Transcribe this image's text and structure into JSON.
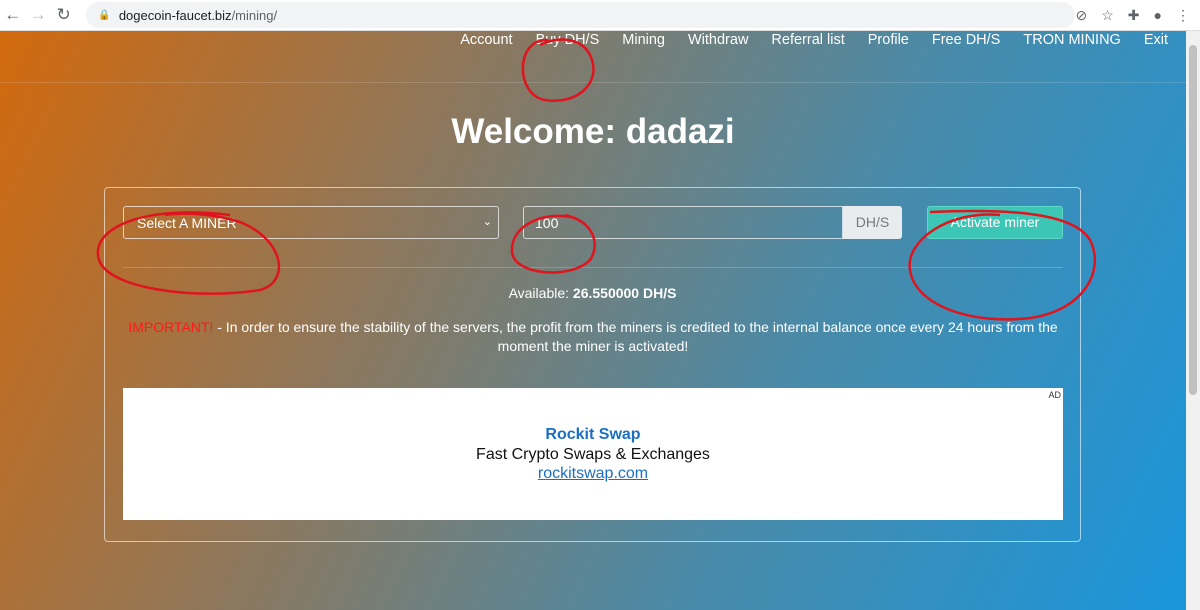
{
  "browser": {
    "url_domain": "dogecoin-faucet.biz",
    "url_path": "/mining/"
  },
  "nav": [
    "Account",
    "Buy DH/S",
    "Mining",
    "Withdraw",
    "Referral list",
    "Profile",
    "Free DH/S",
    "TRON MINING",
    "Exit"
  ],
  "welcome": "Welcome: dadazi",
  "form": {
    "miner_select": "Select A MINER",
    "amount": "100",
    "unit": "DH/S",
    "activate": "Activate miner"
  },
  "available": {
    "label": "Available:",
    "value": "26.550000 DH/S"
  },
  "notice": {
    "important": "IMPORTANT!",
    "text": " - In order to ensure the stability of the servers, the profit from the miners is credited to the internal balance once every 24 hours from the moment the miner is activated!"
  },
  "ad": {
    "label": "AD",
    "title": "Rockit Swap",
    "desc": "Fast Crypto Swaps & Exchanges",
    "link": "rockitswap.com"
  },
  "colors": {
    "annotation": "#e0141e",
    "button": "#3cc6b5"
  }
}
